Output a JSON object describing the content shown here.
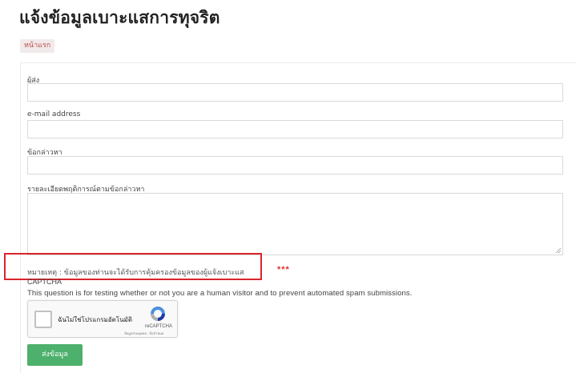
{
  "page": {
    "title": "แจ้งข้อมูลเบาะแสการทุจริต",
    "breadcrumb": "หน้าแรก"
  },
  "form": {
    "sender_label": "ผู้ส่ง",
    "sender_value": "",
    "email_label": "e-mail address",
    "email_value": "",
    "subject_label": "ข้อกล่าวหา",
    "subject_value": "",
    "details_label": "รายละเอียดพฤติการณ์ตามข้อกล่าวหา",
    "details_value": "",
    "note": "หมายเหตุ : ข้อมูลของท่านจะได้รับการคุ้มครองข้อมูลของผู้แจ้งเบาะแส",
    "asterisks": "***"
  },
  "captcha": {
    "title": "CAPTCHA",
    "description": "This question is for testing whether or not you are a human visitor and to prevent automated spam submissions.",
    "checkbox_label": "ฉันไม่ใช่โปรแกรมอัตโนมัติ",
    "brand": "reCAPTCHA",
    "links": "ข้อมูลส่วนบุคคล - ข้อกำหนด",
    "checked": false
  },
  "actions": {
    "submit_label": "ส่งข้อมูล"
  },
  "colors": {
    "submit": "#4db06c",
    "highlight": "#d9252b",
    "asterisks": "#e03030",
    "breadcrumb_text": "#b94a48"
  }
}
